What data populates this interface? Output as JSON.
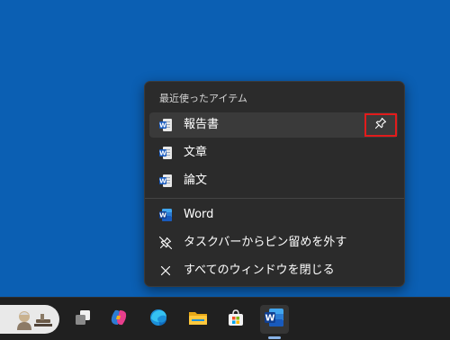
{
  "jumplist": {
    "recent_title": "最近使ったアイテム",
    "recent_items": [
      {
        "label": "報告書",
        "icon": "word-doc-icon"
      },
      {
        "label": "文章",
        "icon": "word-doc-icon"
      },
      {
        "label": "論文",
        "icon": "word-doc-icon"
      }
    ],
    "app_label": "Word",
    "unpin_label": "タスクバーからピン留めを外す",
    "close_all_label": "すべてのウィンドウを閉じる"
  },
  "taskbar": {
    "apps": [
      "task-view",
      "copilot",
      "edge",
      "file-explorer",
      "microsoft-store",
      "word"
    ],
    "active_app": "word"
  },
  "colors": {
    "desktop": "#0b5fb3",
    "menu_bg": "#2b2b2b",
    "highlight_box": "#e21b1b",
    "word_blue": "#185abd"
  }
}
